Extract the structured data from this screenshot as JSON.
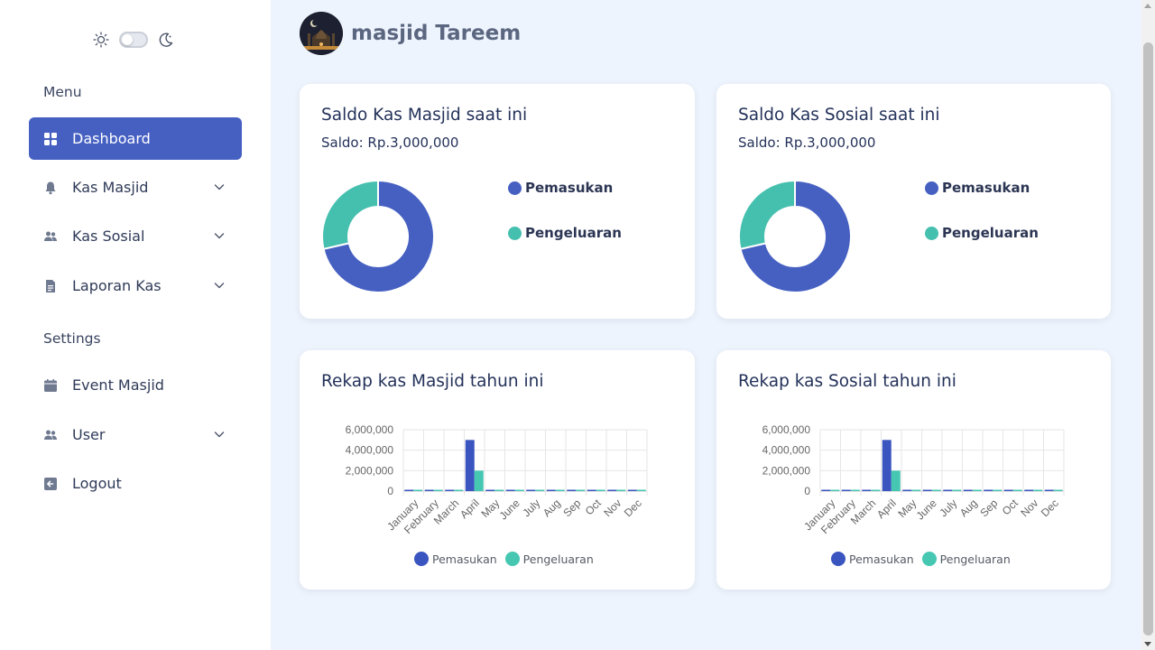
{
  "theme": {
    "mode": "light"
  },
  "sidebar": {
    "menu_label": "Menu",
    "settings_label": "Settings",
    "items": [
      {
        "label": "Dashboard",
        "icon": "dashboard-icon",
        "active": true,
        "has_submenu": false
      },
      {
        "label": "Kas Masjid",
        "icon": "bell-icon",
        "active": false,
        "has_submenu": true
      },
      {
        "label": "Kas Sosial",
        "icon": "users-icon",
        "active": false,
        "has_submenu": true
      },
      {
        "label": "Laporan Kas",
        "icon": "document-icon",
        "active": false,
        "has_submenu": true
      }
    ],
    "settings_items": [
      {
        "label": "Event Masjid",
        "icon": "calendar-icon",
        "has_submenu": false
      },
      {
        "label": "User",
        "icon": "users-icon",
        "has_submenu": true
      },
      {
        "label": "Logout",
        "icon": "logout-icon",
        "has_submenu": false
      }
    ]
  },
  "header": {
    "title": "masjid Tareem"
  },
  "colors": {
    "primary": "#4660c2",
    "income": "#4660c2",
    "expense": "#45bfae",
    "income_bar": "#3a55c0",
    "expense_bar": "#45c7b2"
  },
  "cards": {
    "saldo_masjid": {
      "title": "Saldo Kas Masjid saat ini",
      "saldo": "Saldo: Rp.3,000,000",
      "legend": [
        "Pemasukan",
        "Pengeluaran"
      ]
    },
    "saldo_sosial": {
      "title": "Saldo Kas Sosial saat ini",
      "saldo": "Saldo: Rp.3,000,000",
      "legend": [
        "Pemasukan",
        "Pengeluaran"
      ]
    },
    "rekap_masjid": {
      "title": "Rekap kas Masjid tahun ini"
    },
    "rekap_sosial": {
      "title": "Rekap kas Sosial tahun ini"
    }
  },
  "chart_data": [
    {
      "type": "pie",
      "subtype": "doughnut",
      "labels": [
        "Pemasukan",
        "Pengeluaran"
      ],
      "values": [
        5000000,
        2000000
      ],
      "legend_position": "right"
    },
    {
      "type": "pie",
      "subtype": "doughnut",
      "labels": [
        "Pemasukan",
        "Pengeluaran"
      ],
      "values": [
        5000000,
        2000000
      ],
      "legend_position": "right"
    },
    {
      "type": "bar",
      "categories": [
        "January",
        "February",
        "March",
        "April",
        "May",
        "June",
        "July",
        "Aug",
        "Sep",
        "Oct",
        "Nov",
        "Dec"
      ],
      "series": [
        {
          "name": "Pemasukan",
          "values": [
            0,
            0,
            0,
            5000000,
            0,
            0,
            0,
            0,
            0,
            0,
            0,
            0
          ]
        },
        {
          "name": "Pengeluaran",
          "values": [
            0,
            0,
            0,
            2000000,
            0,
            0,
            0,
            0,
            0,
            0,
            0,
            0
          ]
        }
      ],
      "yticks": [
        "6,000,000",
        "4,000,000",
        "2,000,000",
        "0"
      ],
      "ylim": [
        0,
        6000000
      ],
      "grid": true,
      "legend_position": "bottom"
    },
    {
      "type": "bar",
      "categories": [
        "January",
        "February",
        "March",
        "April",
        "May",
        "June",
        "July",
        "Aug",
        "Sep",
        "Oct",
        "Nov",
        "Dec"
      ],
      "series": [
        {
          "name": "Pemasukan",
          "values": [
            0,
            0,
            0,
            5000000,
            0,
            0,
            0,
            0,
            0,
            0,
            0,
            0
          ]
        },
        {
          "name": "Pengeluaran",
          "values": [
            0,
            0,
            0,
            2000000,
            0,
            0,
            0,
            0,
            0,
            0,
            0,
            0
          ]
        }
      ],
      "yticks": [
        "6,000,000",
        "4,000,000",
        "2,000,000",
        "0"
      ],
      "ylim": [
        0,
        6000000
      ],
      "grid": true,
      "legend_position": "bottom"
    }
  ]
}
